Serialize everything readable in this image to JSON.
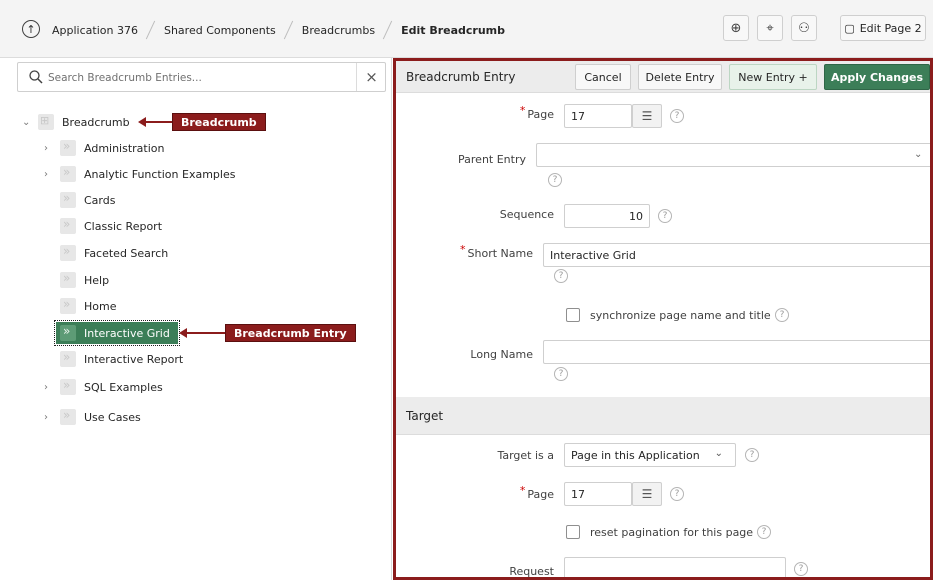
{
  "topbar": {
    "breadcrumbs": [
      "Application 376",
      "Shared Components",
      "Breadcrumbs",
      "Edit Breadcrumb"
    ],
    "edit_page_label": "Edit Page 2"
  },
  "search": {
    "placeholder": "Search Breadcrumb Entries...",
    "value": ""
  },
  "tree": {
    "root": "Breadcrumb",
    "items": [
      "Administration",
      "Analytic Function Examples",
      "Cards",
      "Classic Report",
      "Faceted Search",
      "Help",
      "Home",
      "Interactive Grid",
      "Interactive Report",
      "SQL Examples",
      "Use Cases"
    ]
  },
  "callouts": {
    "breadcrumb": "Breadcrumb",
    "entry": "Breadcrumb Entry"
  },
  "entry_section": {
    "title": "Breadcrumb Entry",
    "cancel": "Cancel",
    "delete": "Delete Entry",
    "new_entry": "New Entry +",
    "apply": "Apply Changes",
    "page_label": "Page",
    "page_value": "17",
    "parent_label": "Parent Entry",
    "parent_value": "",
    "sequence_label": "Sequence",
    "sequence_value": "10",
    "short_name_label": "Short Name",
    "short_name_value": "Interactive Grid",
    "sync_label": "synchronize page name and title",
    "long_name_label": "Long Name",
    "long_name_value": ""
  },
  "target_section": {
    "title": "Target",
    "target_is_label": "Target is a",
    "target_is_value": "Page in this Application",
    "page_label": "Page",
    "page_value": "17",
    "reset_label": "reset pagination for this page",
    "request_label": "Request",
    "request_value": ""
  }
}
